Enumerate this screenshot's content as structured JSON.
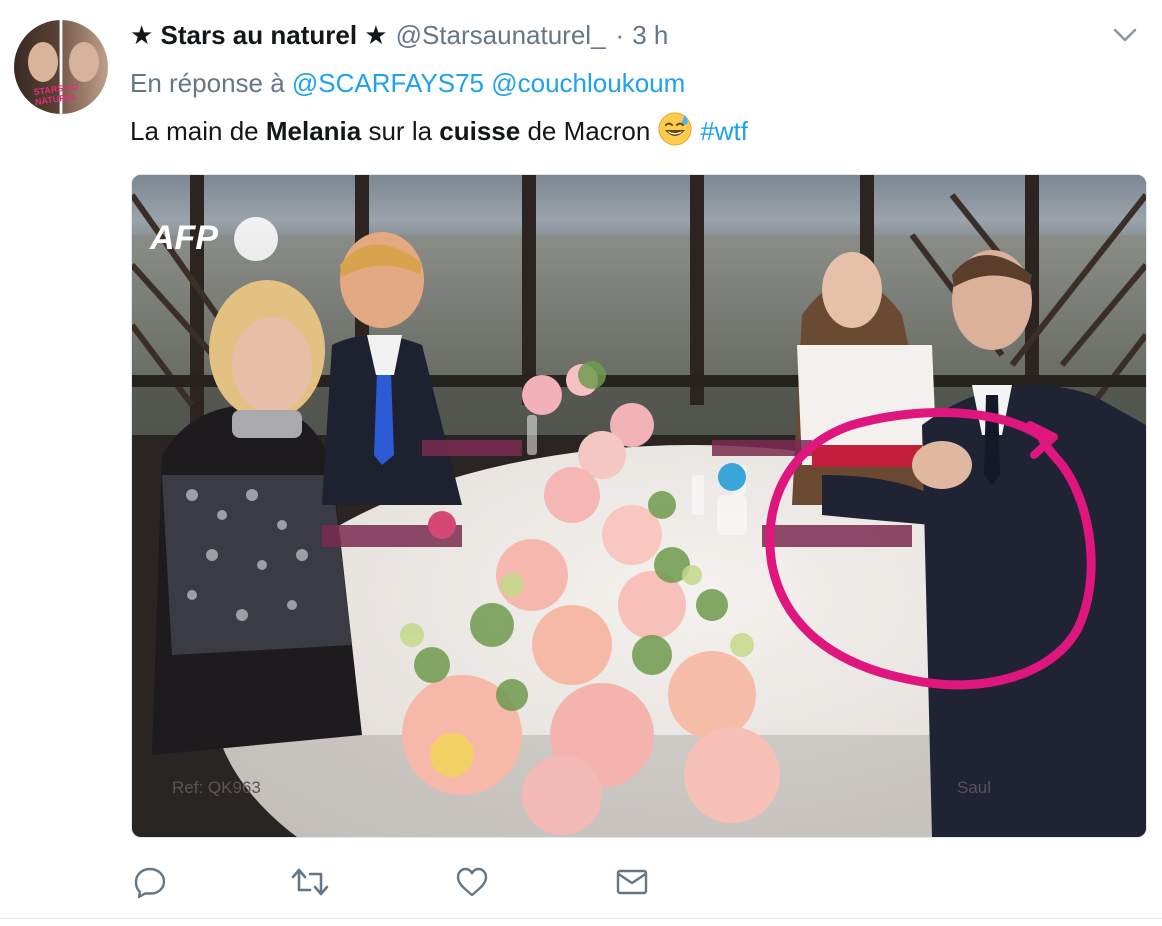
{
  "tweet": {
    "display_name": "★ Stars au naturel ★",
    "handle": "@Starsaunaturel_",
    "separator": "·",
    "time": "3 h",
    "reply_prefix": "En réponse à",
    "reply_mentions": [
      "@SCARFAYS75",
      "@couchloukoum"
    ],
    "text_segments": {
      "s1": "La main de ",
      "s2_bold": "Melania",
      "s3": " sur la ",
      "s4_bold": "cuisse",
      "s5": " de Macron",
      "emoji": "grinning-face-with-sweat",
      "hashtag": "#wtf"
    },
    "media": {
      "watermark": "AFP",
      "ref_text": "Ref: QK963",
      "credit_text": "Saul",
      "annotation_color": "#e0167f"
    },
    "avatar_text": "STARS AU NATUREL"
  },
  "actions": [
    {
      "name": "reply-icon"
    },
    {
      "name": "retweet-icon"
    },
    {
      "name": "like-icon"
    },
    {
      "name": "message-icon"
    }
  ],
  "colors": {
    "link": "#1da1f2",
    "muted": "#657786",
    "text": "#14171a",
    "icon": "#657786"
  }
}
